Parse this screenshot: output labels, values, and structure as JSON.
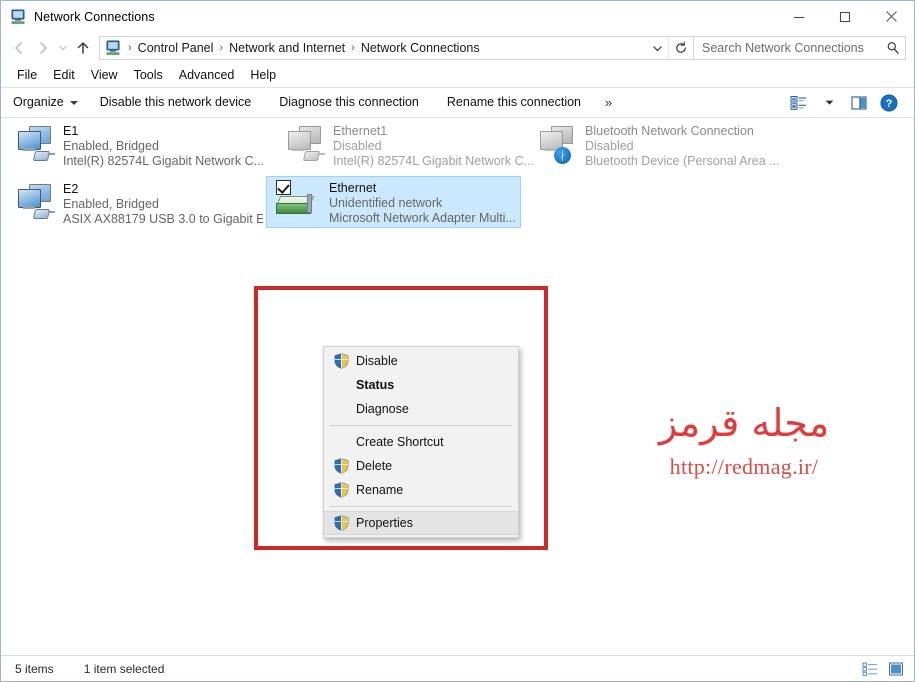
{
  "window": {
    "title": "Network Connections",
    "title_icon": "network-connections-icon",
    "controls": {
      "minimize": "minimize-icon",
      "maximize": "maximize-icon",
      "close": "close-icon"
    }
  },
  "address_bar": {
    "back_icon": "back-arrow-icon",
    "forward_icon": "forward-arrow-icon",
    "recent_icon": "recent-locations-icon",
    "up_icon": "up-arrow-icon",
    "crumb_icon": "network-connections-icon",
    "breadcrumbs": [
      "Control Panel",
      "Network and Internet",
      "Network Connections"
    ],
    "separator": "›",
    "dropdown_icon": "chevron-down-icon",
    "refresh_icon": "refresh-icon"
  },
  "search": {
    "placeholder": "Search Network Connections",
    "value": "",
    "icon": "search-icon"
  },
  "menubar": {
    "items": [
      "File",
      "Edit",
      "View",
      "Tools",
      "Advanced",
      "Help"
    ]
  },
  "command_bar": {
    "organize_label": "Organize",
    "commands": [
      "Disable this network device",
      "Diagnose this connection",
      "Rename this connection"
    ],
    "overflow": "»",
    "right_icons": [
      "change-view-icon",
      "view-dropdown-chevron-icon",
      "preview-pane-icon",
      "help-icon"
    ]
  },
  "connections": [
    {
      "name": "E1",
      "status": "Enabled, Bridged",
      "device": "Intel(R) 82574L Gigabit Network C...",
      "icon": "network-adapter-enabled-icon",
      "enabled": true,
      "selected": false
    },
    {
      "name": "Ethernet1",
      "status": "Disabled",
      "device": "Intel(R) 82574L Gigabit Network C...",
      "icon": "network-adapter-disabled-icon",
      "enabled": false,
      "selected": false
    },
    {
      "name": "Bluetooth Network Connection",
      "status": "Disabled",
      "device": "Bluetooth Device (Personal Area ...",
      "icon": "bluetooth-network-adapter-icon",
      "enabled": false,
      "selected": false
    },
    {
      "name": "E2",
      "status": "Enabled, Bridged",
      "device": "ASIX AX88179 USB 3.0 to Gigabit E...",
      "icon": "network-adapter-enabled-icon",
      "enabled": true,
      "selected": false
    },
    {
      "name": "Ethernet",
      "status": "Unidentified network",
      "device": "Microsoft Network Adapter Multi...",
      "icon": "ethernet-card-icon",
      "enabled": true,
      "selected": true,
      "checkbox_checked": true
    }
  ],
  "context_menu": {
    "items": [
      {
        "label": "Disable",
        "icon": "uac-shield-icon",
        "bold": false,
        "highlighted": false,
        "separator_after": false
      },
      {
        "label": "Status",
        "icon": "",
        "bold": true,
        "highlighted": false,
        "separator_after": false
      },
      {
        "label": "Diagnose",
        "icon": "",
        "bold": false,
        "highlighted": false,
        "separator_after": true
      },
      {
        "label": "Create Shortcut",
        "icon": "",
        "bold": false,
        "highlighted": false,
        "separator_after": false
      },
      {
        "label": "Delete",
        "icon": "uac-shield-icon",
        "bold": false,
        "highlighted": false,
        "separator_after": false
      },
      {
        "label": "Rename",
        "icon": "uac-shield-icon",
        "bold": false,
        "highlighted": false,
        "separator_after": true
      },
      {
        "label": "Properties",
        "icon": "uac-shield-icon",
        "bold": false,
        "highlighted": true,
        "separator_after": false
      }
    ]
  },
  "annotation": {
    "type": "red-rectangle-highlight",
    "color": "#cc2a2a"
  },
  "watermark": {
    "text_fa": "مجله قرمز",
    "url": "http://redmag.ir/",
    "color": "#e23b3b"
  },
  "status_bar": {
    "item_count": "5 items",
    "selection": "1 item selected",
    "icons": [
      "details-view-icon",
      "large-icons-view-icon"
    ]
  }
}
